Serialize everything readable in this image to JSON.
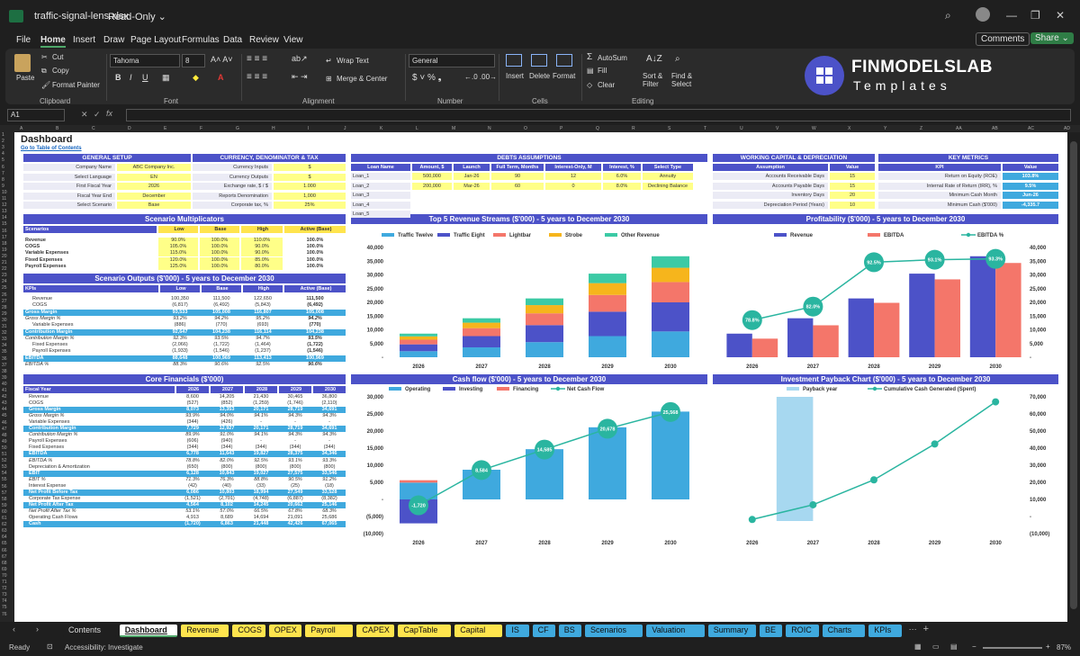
{
  "window": {
    "filename": "traffic-signal-lens.xlsx",
    "mode": "Read-Only ⌄"
  },
  "menu": [
    "File",
    "Home",
    "Insert",
    "Draw",
    "Page Layout",
    "Formulas",
    "Data",
    "Review",
    "View"
  ],
  "buttons": {
    "comments": "Comments",
    "share": "Share ⌄"
  },
  "ribbon": {
    "paste": "Paste",
    "cut": "Cut",
    "copy": "Copy",
    "format_painter": "Format Painter",
    "clipboard": "Clipboard",
    "font_name": "Tahoma",
    "font_size": "8",
    "font": "Font",
    "wrap_text": "Wrap Text",
    "merge_center": "Merge & Center",
    "alignment": "Alignment",
    "number_format": "General",
    "number": "Number",
    "insert": "Insert",
    "delete": "Delete",
    "format": "Format",
    "cells": "Cells",
    "autosum": "AutoSum",
    "fill": "Fill",
    "clear": "Clear",
    "sort_filter": "Sort & Filter",
    "find_select": "Find & Select",
    "editing": "Editing"
  },
  "brand": {
    "name": "FINMODELSLAB",
    "sub": "Templates"
  },
  "formula_bar": {
    "name_box": "A1",
    "formula": ""
  },
  "columns": [
    "A",
    "B",
    "C",
    "D",
    "E",
    "F",
    "G",
    "H",
    "I",
    "J",
    "K",
    "L",
    "M",
    "N",
    "O",
    "P",
    "Q",
    "R",
    "S",
    "T",
    "U",
    "V",
    "W",
    "X",
    "Y",
    "Z",
    "AA",
    "AB",
    "AC",
    "AD"
  ],
  "sheet": {
    "title": "Dashboard",
    "link": "Go to Table of Contents",
    "general_setup": {
      "header": "GENERAL SETUP",
      "rows": [
        [
          "Company Name",
          "ABC Company Inc."
        ],
        [
          "Select Language",
          "EN"
        ],
        [
          "First Fiscal Year",
          "2026"
        ],
        [
          "Fiscal Year End",
          "December"
        ],
        [
          "Select Scenario",
          "Base"
        ]
      ]
    },
    "currency": {
      "header": "CURRENCY, DENOMINATOR & TAX",
      "rows": [
        [
          "Currency Inputs",
          "$"
        ],
        [
          "Currency Outputs",
          "$"
        ],
        [
          "Exchange rate, $ / $",
          "1.000"
        ],
        [
          "Reports Denomination",
          "1,000"
        ],
        [
          "Corporate tax, %",
          "25%"
        ]
      ]
    },
    "debts": {
      "header": "DEBTS ASSUMPTIONS",
      "cols": [
        "Loan Name",
        "Amount, $",
        "Launch",
        "Full Term, Months",
        "Interest-Only, M",
        "Interest, %",
        "Select Type"
      ],
      "rows": [
        [
          "Loan_1",
          "500,000",
          "Jan-26",
          "90",
          "12",
          "6.0%",
          "Annuity"
        ],
        [
          "Loan_2",
          "200,000",
          "Mar-26",
          "60",
          "0",
          "8.0%",
          "Declining Balance"
        ],
        [
          "Loan_3",
          "",
          "",
          "",
          "",
          "",
          ""
        ],
        [
          "Loan_4",
          "",
          "",
          "",
          "",
          "",
          ""
        ],
        [
          "Loan_5",
          "",
          "",
          "",
          "",
          "",
          ""
        ]
      ]
    },
    "working_capital": {
      "header": "WORKING CAPITAL & DEPRECIATION",
      "cols": [
        "Assumption",
        "Value"
      ],
      "rows": [
        [
          "Accounts Receivable Days",
          "15"
        ],
        [
          "Accounts Payable Days",
          "15"
        ],
        [
          "Inventory Days",
          "20"
        ],
        [
          "Depreciation Period (Years)",
          "10"
        ]
      ]
    },
    "kpis": {
      "header": "KEY METRICS",
      "cols": [
        "KPI",
        "Value"
      ],
      "rows": [
        [
          "Return on Equity (ROE)",
          "103.8%"
        ],
        [
          "Internal Rate of Return (IRR), %",
          "9.5%"
        ],
        [
          "Minimum Cash Month",
          "Jun-26"
        ],
        [
          "Minimum Cash ($'000)",
          "-4,335.7"
        ]
      ]
    },
    "scenario_mult": {
      "header": "Scenario Multiplicators",
      "cols": [
        "Scenarios",
        "Low",
        "Base",
        "High",
        "Active (Base)"
      ],
      "rows": [
        [
          "Revenue",
          "90.0%",
          "100.0%",
          "110.0%",
          "100.0%"
        ],
        [
          "COGS",
          "105.0%",
          "100.0%",
          "90.0%",
          "100.0%"
        ],
        [
          "Variable Expenses",
          "115.0%",
          "100.0%",
          "90.0%",
          "100.0%"
        ],
        [
          "Fixed Expenses",
          "120.0%",
          "100.0%",
          "85.0%",
          "100.0%"
        ],
        [
          "Payroll Expenses",
          "125.0%",
          "100.0%",
          "80.0%",
          "100.0%"
        ]
      ]
    },
    "scenario_out": {
      "header": "Scenario Outputs ($'000) - 5 years to December 2030",
      "cols": [
        "KPIs",
        "Low",
        "Base",
        "High",
        "Active (Base)"
      ],
      "rows": [
        [
          "Revenue",
          "100,350",
          "111,500",
          "122,650",
          "111,500",
          0
        ],
        [
          "COGS",
          "(6,817)",
          "(6,492)",
          "(5,843)",
          "(6,492)",
          0
        ],
        [
          "Gross Margin",
          "93,533",
          "105,008",
          "116,807",
          "105,008",
          1
        ],
        [
          "Gross Margin %",
          "93.2%",
          "94.2%",
          "95.2%",
          "94.2%",
          0
        ],
        [
          "Variable Expenses",
          "(886)",
          "(770)",
          "(693)",
          "(770)",
          0
        ],
        [
          "Contribution Margin",
          "92,647",
          "104,238",
          "116,114",
          "104,238",
          1
        ],
        [
          "Contribution Margin %",
          "92.3%",
          "93.5%",
          "94.7%",
          "93.5%",
          0
        ],
        [
          "Fixed Expenses",
          "(2,066)",
          "(1,722)",
          "(1,464)",
          "(1,722)",
          0
        ],
        [
          "Payroll Expenses",
          "(1,933)",
          "(1,546)",
          "(1,237)",
          "(1,546)",
          0
        ],
        [
          "EBITDA",
          "88,648",
          "100,969",
          "113,413",
          "100,969",
          1
        ],
        [
          "EBITDA %",
          "88.3%",
          "90.6%",
          "92.5%",
          "90.6%",
          0
        ]
      ]
    },
    "core": {
      "header": "Core Financials ($'000)",
      "cols": [
        "Fiscal Year",
        "2026",
        "2027",
        "2028",
        "2029",
        "2030"
      ],
      "rows": [
        [
          "Revenue",
          "8,600",
          "14,205",
          "21,430",
          "30,465",
          "36,800",
          0
        ],
        [
          "COGS",
          "(527)",
          "(852)",
          "(1,259)",
          "(1,746)",
          "(2,110)",
          0
        ],
        [
          "Gross Margin",
          "8,073",
          "13,353",
          "20,171",
          "28,719",
          "34,691",
          1
        ],
        [
          "Gross Margin %",
          "93.9%",
          "94.0%",
          "94.1%",
          "94.3%",
          "94.3%",
          0
        ],
        [
          "Variable Expenses",
          "(344)",
          "(426)",
          "-",
          "-",
          "-",
          0
        ],
        [
          "Contribution Margin",
          "7,729",
          "12,927",
          "20,171",
          "28,719",
          "34,691",
          1
        ],
        [
          "Contribution Margin %",
          "89.9%",
          "91.0%",
          "94.1%",
          "94.3%",
          "94.3%",
          0
        ],
        [
          "Payroll Expenses",
          "(606)",
          "(940)",
          "-",
          "-",
          "-",
          0
        ],
        [
          "Fixed Expenses",
          "(344)",
          "(344)",
          "(344)",
          "(344)",
          "(344)",
          0
        ],
        [
          "EBITDA",
          "6,778",
          "11,643",
          "19,827",
          "28,375",
          "34,346",
          1
        ],
        [
          "EBITDA %",
          "78.8%",
          "82.0%",
          "92.5%",
          "93.1%",
          "93.3%",
          0
        ],
        [
          "Depreciation & Amortization",
          "(650)",
          "(800)",
          "(800)",
          "(800)",
          "(800)",
          0
        ],
        [
          "EBIT",
          "6,128",
          "10,843",
          "19,027",
          "27,575",
          "33,546",
          1
        ],
        [
          "EBIT %",
          "71.3%",
          "76.3%",
          "88.8%",
          "90.5%",
          "91.2%",
          0
        ],
        [
          "Interest Expense",
          "(42)",
          "(40)",
          "(33)",
          "(25)",
          "(18)",
          0
        ],
        [
          "Net Profit Before Tax",
          "6,086",
          "10,803",
          "18,994",
          "27,549",
          "33,528",
          1
        ],
        [
          "Corporate Tax Expense",
          "(1,521)",
          "(2,701)",
          "(4,748)",
          "(6,887)",
          "(8,382)",
          0
        ],
        [
          "Net Profit After Tax",
          "4,564",
          "8,102",
          "14,245",
          "20,662",
          "25,146",
          1
        ],
        [
          "Net Profit After Tax %",
          "53.1%",
          "57.0%",
          "66.5%",
          "67.8%",
          "68.3%",
          0
        ],
        [
          "Operating Cash Flows",
          "4,913",
          "8,689",
          "14,694",
          "21,091",
          "25,686",
          0
        ],
        [
          "Cash",
          "(1,720)",
          "6,863",
          "21,448",
          "42,426",
          "67,065",
          1
        ]
      ]
    }
  },
  "chart_data": [
    {
      "type": "bar",
      "title": "Top 5 Revenue Streams ($'000) - 5 years to December 2030",
      "categories": [
        "2026",
        "2027",
        "2028",
        "2029",
        "2030"
      ],
      "stacked": true,
      "ylim": [
        0,
        40000
      ],
      "yticks": [
        "-",
        "5,000",
        "10,000",
        "15,000",
        "20,000",
        "25,000",
        "30,000",
        "35,000",
        "40,000"
      ],
      "series": [
        {
          "name": "Traffic Twelve",
          "color": "#3fa9de",
          "values": [
            2200,
            3600,
            5500,
            7700,
            9400
          ]
        },
        {
          "name": "Traffic Eight",
          "color": "#4c52c8",
          "values": [
            2500,
            4100,
            6200,
            8900,
            10600
          ]
        },
        {
          "name": "Lightbar",
          "color": "#f4766a",
          "values": [
            1700,
            2900,
            4300,
            6100,
            7400
          ]
        },
        {
          "name": "Strobe",
          "color": "#f6b51c",
          "values": [
            1200,
            2000,
            3000,
            4300,
            5200
          ]
        },
        {
          "name": "Other Revenue",
          "color": "#3ccaa5",
          "values": [
            1000,
            1605,
            2430,
            3465,
            4200
          ]
        }
      ]
    },
    {
      "type": "bar",
      "title": "Profitability ($'000) - 5 years to December 2030",
      "categories": [
        "2026",
        "2027",
        "2028",
        "2029",
        "2030"
      ],
      "ylim": [
        0,
        40000
      ],
      "yticks": [
        "-",
        "5,000",
        "10,000",
        "15,000",
        "20,000",
        "25,000",
        "30,000",
        "35,000",
        "40,000"
      ],
      "series": [
        {
          "name": "Revenue",
          "color": "#4c52c8",
          "values": [
            8600,
            14205,
            21430,
            30465,
            36800
          ]
        },
        {
          "name": "EBITDA",
          "color": "#f4766a",
          "values": [
            6778,
            11643,
            19827,
            28375,
            34346
          ]
        }
      ],
      "line": {
        "name": "EBITDA %",
        "color": "#2ab5a0",
        "values": [
          78.8,
          82.0,
          92.5,
          93.1,
          93.3
        ],
        "labels": [
          "78.8%",
          "82.0%",
          "92.5%",
          "93.1%",
          "93.3%"
        ]
      }
    },
    {
      "type": "bar",
      "title": "Cash flow ($'000) - 5 years to December 2030",
      "categories": [
        "2026",
        "2027",
        "2028",
        "2029",
        "2030"
      ],
      "ylim": [
        -10000,
        30000
      ],
      "yticks": [
        "(10,000)",
        "(5,000)",
        "-",
        "5,000",
        "10,000",
        "15,000",
        "20,000",
        "25,000",
        "30,000"
      ],
      "series": [
        {
          "name": "Operating",
          "color": "#3fa9de",
          "values": [
            4913,
            8689,
            14694,
            21091,
            25686
          ]
        },
        {
          "name": "Investing",
          "color": "#4c52c8",
          "values": [
            -7000,
            0,
            0,
            0,
            0
          ]
        },
        {
          "name": "Financing",
          "color": "#f4766a",
          "values": [
            700,
            0,
            0,
            0,
            0
          ]
        }
      ],
      "line": {
        "name": "Net Cash Flow",
        "color": "#2ab5a0",
        "values": [
          -1720,
          8584,
          14585,
          20678,
          25568
        ],
        "labels": [
          "-1,720",
          "8,584",
          "14,585",
          "20,678",
          "25,568"
        ]
      }
    },
    {
      "type": "line",
      "title": "Investment Payback Chart ($'000) - 5 years to December 2030",
      "categories": [
        "2026",
        "2027",
        "2028",
        "2029",
        "2030"
      ],
      "ylim": [
        -10000,
        70000
      ],
      "yticks": [
        "(10,000)",
        "-",
        "10,000",
        "20,000",
        "30,000",
        "40,000",
        "50,000",
        "60,000",
        "70,000"
      ],
      "payback": {
        "name": "Payback year",
        "color": "#a7d8f0",
        "category": "2027"
      },
      "line": {
        "name": "Cumulative Cash Generated (Spent)",
        "color": "#2ab5a0",
        "values": [
          -1720,
          6863,
          21448,
          42426,
          67065
        ]
      }
    }
  ],
  "sheet_tabs": [
    {
      "label": "Contents",
      "bg": "#1f1f1f",
      "fg": "#ddd"
    },
    {
      "label": "Dashboard",
      "bg": "#ffffff",
      "fg": "#111",
      "active": true
    },
    {
      "label": "Revenue",
      "bg": "#ffe44d"
    },
    {
      "label": "COGS",
      "bg": "#ffe44d"
    },
    {
      "label": "OPEX",
      "bg": "#ffe44d"
    },
    {
      "label": "Payroll",
      "bg": "#ffe44d"
    },
    {
      "label": "CAPEX",
      "bg": "#ffe44d"
    },
    {
      "label": "CapTable",
      "bg": "#ffe44d"
    },
    {
      "label": "Capital",
      "bg": "#ffe44d"
    },
    {
      "label": "IS",
      "bg": "#3fa9de"
    },
    {
      "label": "CF",
      "bg": "#3fa9de"
    },
    {
      "label": "BS",
      "bg": "#3fa9de"
    },
    {
      "label": "Scenarios",
      "bg": "#3fa9de"
    },
    {
      "label": "Valuation",
      "bg": "#3fa9de"
    },
    {
      "label": "Summary",
      "bg": "#3fa9de"
    },
    {
      "label": "BE",
      "bg": "#3fa9de"
    },
    {
      "label": "ROIC",
      "bg": "#3fa9de"
    },
    {
      "label": "Charts",
      "bg": "#3fa9de"
    },
    {
      "label": "KPIs",
      "bg": "#3fa9de"
    }
  ],
  "status": {
    "ready": "Ready",
    "accessibility": "Accessibility: Investigate",
    "zoom": "87%"
  }
}
